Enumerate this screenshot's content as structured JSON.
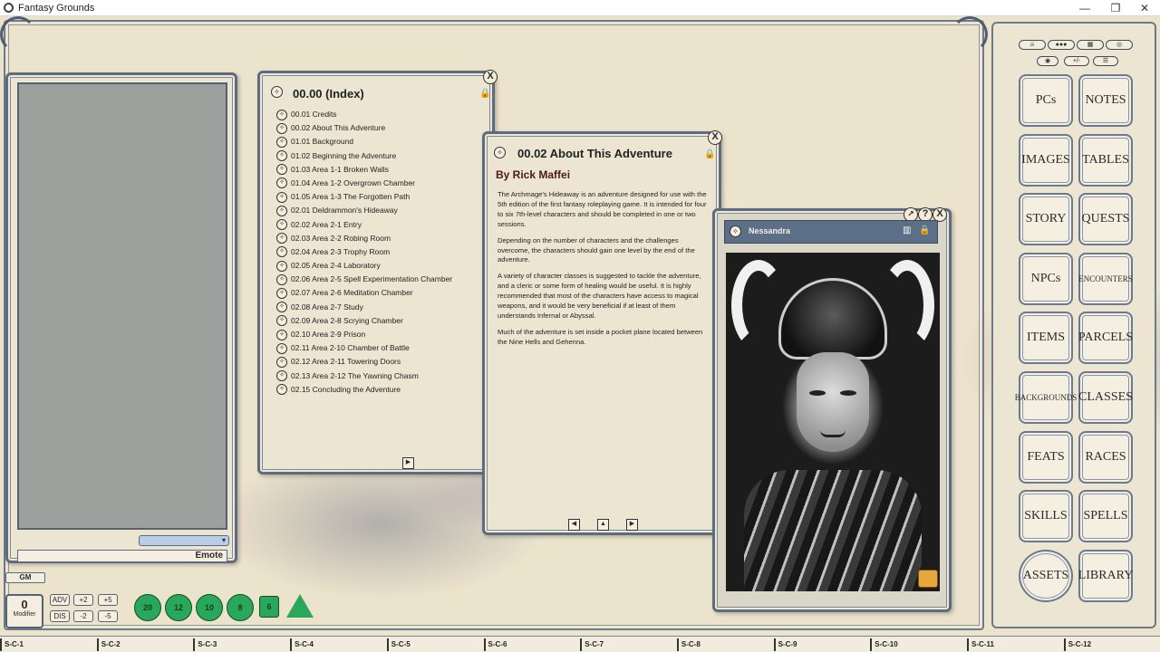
{
  "window": {
    "title": "Fantasy Grounds",
    "minimize": "—",
    "restore": "❐",
    "close": "✕"
  },
  "chat": {
    "entry_label": "Emote",
    "mode_arrow": "▾"
  },
  "gm_tab": "GM",
  "modifier": {
    "value": "0",
    "label": "Modifier"
  },
  "mod_buttons": [
    "ADV",
    "+2",
    "+5",
    "DIS",
    "-2",
    "-5"
  ],
  "dice": [
    "20",
    "12",
    "10",
    "8",
    "6",
    ""
  ],
  "index_panel": {
    "title": "00.00 (Index)",
    "items": [
      "00.01 Credits",
      "00.02 About This Adventure",
      "01.01 Background",
      "01.02 Beginning the Adventure",
      "01.03 Area 1-1 Broken Walls",
      "01.04 Area 1-2 Overgrown Chamber",
      "01.05 Area 1-3 The Forgotten Path",
      "02.01 Deldrammon's Hideaway",
      "02.02 Area 2-1 Entry",
      "02.03 Area 2-2 Robing Room",
      "02.04 Area 2-3 Trophy Room",
      "02.05 Area 2-4 Laboratory",
      "02.06 Area 2-5 Spell Experimentation Chamber",
      "02.07 Area 2-6 Meditation Chamber",
      "02.08 Area 2-7 Study",
      "02.09 Area 2-8 Scrying Chamber",
      "02.10 Area 2-9 Prison",
      "02.11 Area 2-10 Chamber of Battle",
      "02.12 Area 2-11 Towering Doors",
      "02.13 Area 2-12 The Yawning Chasm",
      "02.15 Concluding the Adventure"
    ]
  },
  "about_panel": {
    "title": "00.02 About This Adventure",
    "author": "By Rick Maffei",
    "paragraphs": [
      "The Archmage's Hideaway is an adventure designed for use with the 5th edition of the first fantasy roleplaying game. It is intended for four to six 7th-level characters and should be completed in one or two sessions.",
      "Depending on the number of characters and the challenges overcome, the characters should gain one level by the end of the adventure.",
      "A variety of character classes is suggested to tackle the adventure, and a cleric or some form of healing would be useful. It is highly recommended that most of the characters have access to magical weapons, and it would be very beneficial if at least of them understands Infernal or Abyssal.",
      "Much of the adventure is set inside a pocket plane located between the Nine Hells and Gehenna."
    ]
  },
  "image_panel": {
    "name": "Nessandra"
  },
  "sidebar": {
    "buttons": [
      "PCs",
      "NOTES",
      "IMAGES",
      "TABLES",
      "STORY",
      "QUESTS",
      "NPCs",
      "ENCOUNTERS",
      "ITEMS",
      "PARCELS",
      "BACKGROUNDS",
      "CLASSES",
      "FEATS",
      "RACES",
      "SKILLS",
      "SPELLS",
      "ASSETS",
      "LIBRARY"
    ]
  },
  "hotkeys": [
    "S-C-1",
    "S-C-2",
    "S-C-3",
    "S-C-4",
    "S-C-5",
    "S-C-6",
    "S-C-7",
    "S-C-8",
    "S-C-9",
    "S-C-10",
    "S-C-11",
    "S-C-12"
  ]
}
